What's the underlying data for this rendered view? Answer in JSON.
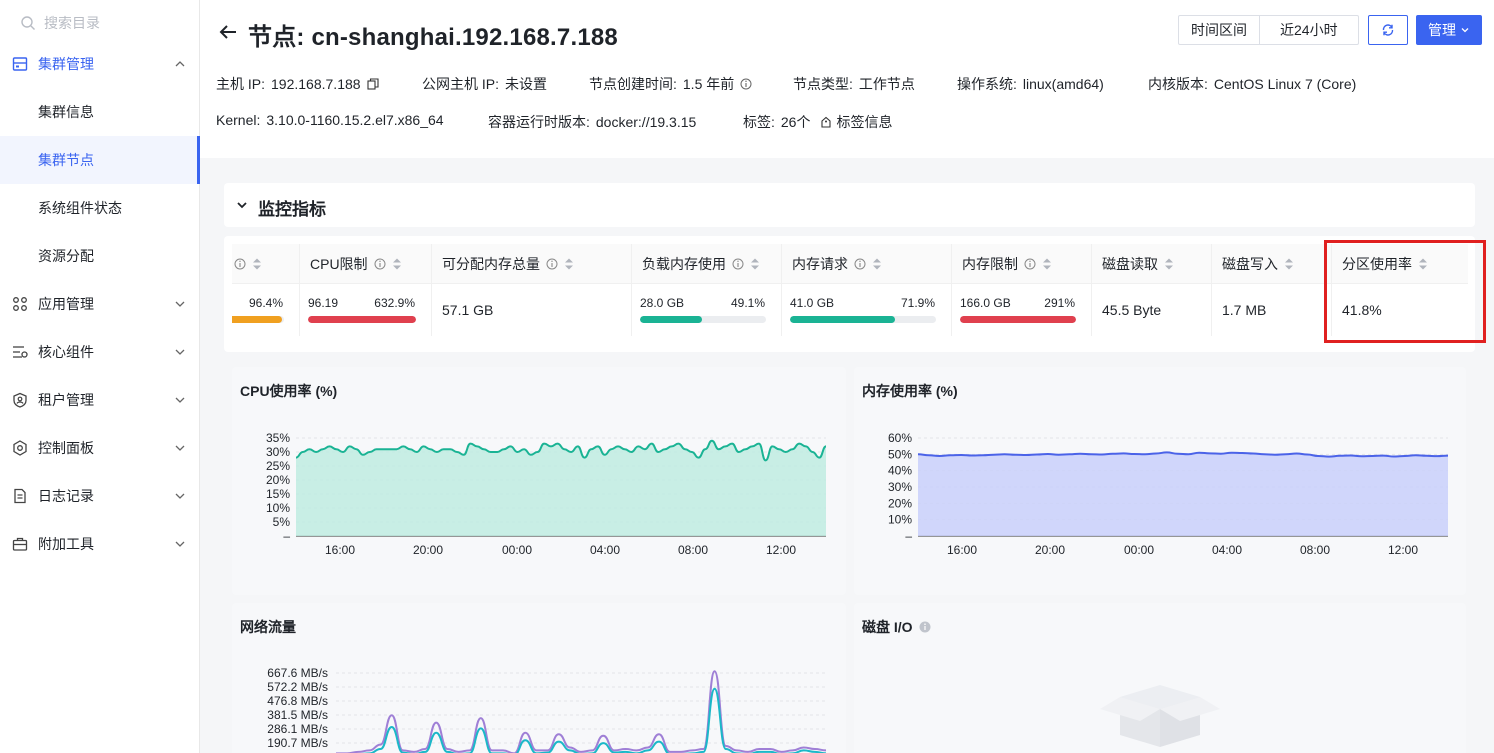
{
  "sidebar": {
    "search_placeholder": "搜索目录",
    "groups": [
      {
        "label": "集群管理",
        "icon": "cluster-icon",
        "expanded": true
      },
      {
        "label": "应用管理",
        "icon": "apps-icon"
      },
      {
        "label": "核心组件",
        "icon": "components-icon"
      },
      {
        "label": "租户管理",
        "icon": "tenant-icon"
      },
      {
        "label": "控制面板",
        "icon": "gear-icon"
      },
      {
        "label": "日志记录",
        "icon": "log-icon"
      },
      {
        "label": "附加工具",
        "icon": "toolbox-icon"
      }
    ],
    "sub_items": [
      "集群信息",
      "集群节点",
      "系统组件状态",
      "资源分配"
    ],
    "active_sub": "集群节点"
  },
  "header": {
    "title": "节点: cn-shanghai.192.168.7.188",
    "time_range_label": "时间区间",
    "time_range_value": "近24小时",
    "manage_label": "管理",
    "meta_row1": [
      {
        "key": "主机 IP:",
        "value": "192.168.7.188"
      },
      {
        "key": "公网主机 IP:",
        "value": "未设置"
      },
      {
        "key": "节点创建时间:",
        "value": "1.5 年前"
      },
      {
        "key": "节点类型:",
        "value": "工作节点"
      },
      {
        "key": "操作系统:",
        "value": "linux(amd64)"
      },
      {
        "key": "内核版本:",
        "value": "CentOS Linux 7 (Core)"
      }
    ],
    "meta_row2": [
      {
        "key": "Kernel:",
        "value": "3.10.0-1160.15.2.el7.x86_64"
      },
      {
        "key": "容器运行时版本:",
        "value": "docker://19.3.15"
      },
      {
        "key": "标签:",
        "value": "26个"
      },
      {
        "key": "",
        "value": "标签信息"
      }
    ]
  },
  "monitor": {
    "section_title": "监控指标",
    "columns": [
      {
        "header": "",
        "left": "",
        "right": "96.4%",
        "fraction": 0.96,
        "color": "#f0a020"
      },
      {
        "header": "CPU限制",
        "left": "96.19",
        "right": "632.9%",
        "fraction": 1.0,
        "color": "#e0404e"
      },
      {
        "header": "可分配内存总量",
        "value": "57.1 GB"
      },
      {
        "header": "负载内存使用",
        "left": "28.0 GB",
        "right": "49.1%",
        "fraction": 0.491,
        "color": "#1ab394"
      },
      {
        "header": "内存请求",
        "left": "41.0 GB",
        "right": "71.9%",
        "fraction": 0.719,
        "color": "#1ab394"
      },
      {
        "header": "内存限制",
        "left": "166.0 GB",
        "right": "291%",
        "fraction": 1.0,
        "color": "#e0404e"
      },
      {
        "header": "磁盘读取",
        "value": "45.5 Byte"
      },
      {
        "header": "磁盘写入",
        "value": "1.7 MB"
      },
      {
        "header": "分区使用率",
        "value": "41.8%"
      }
    ]
  },
  "charts": {
    "cpu_title": "CPU使用率 (%)",
    "mem_title": "内存使用率 (%)",
    "net_title": "网络流量",
    "disk_title": "磁盘 I/O"
  },
  "chart_data": [
    {
      "type": "area",
      "title": "CPU使用率 (%)",
      "x_ticks": [
        "16:00",
        "20:00",
        "00:00",
        "04:00",
        "08:00",
        "12:00"
      ],
      "y_ticks": [
        "–",
        "5%",
        "10%",
        "15%",
        "20%",
        "25%",
        "30%",
        "35%"
      ],
      "ylim": [
        0,
        35
      ],
      "color": "#1ab394",
      "fill": "#bfece0",
      "values": [
        28,
        30,
        31,
        30,
        31,
        32,
        31,
        30,
        32,
        31,
        29,
        30,
        31,
        31,
        31,
        31,
        32,
        31,
        30,
        32,
        31,
        30,
        31,
        31,
        30,
        29,
        33,
        32,
        31,
        30,
        30,
        31,
        32,
        30,
        31,
        29,
        30,
        33,
        32,
        33,
        31,
        30,
        32,
        28,
        31,
        32,
        29,
        31,
        32,
        31,
        30,
        32,
        31,
        33,
        30,
        31,
        32,
        33,
        31,
        30,
        28,
        31,
        34,
        31,
        32,
        33,
        30,
        31,
        32,
        33,
        27,
        32,
        31,
        30,
        31,
        33,
        32,
        30,
        28,
        32
      ]
    },
    {
      "type": "area",
      "title": "内存使用率 (%)",
      "x_ticks": [
        "16:00",
        "20:00",
        "00:00",
        "04:00",
        "08:00",
        "12:00"
      ],
      "y_ticks": [
        "–",
        "10%",
        "20%",
        "30%",
        "40%",
        "50%",
        "60%"
      ],
      "ylim": [
        0,
        60
      ],
      "color": "#4b63e8",
      "fill": "#c9d0fa",
      "values": [
        50,
        49.5,
        49,
        49.4,
        49.6,
        49.3,
        49.5,
        49.8,
        50,
        49.7,
        49.6,
        49.9,
        50.2,
        49.8,
        50,
        50.4,
        50.1,
        49.9,
        50.3,
        50.6,
        50.2,
        50,
        50.5,
        51.2,
        50.4,
        50.1,
        51,
        50.6,
        50.4,
        51,
        50.8,
        50.5,
        50,
        49.8,
        50.1,
        50.5,
        49.9,
        49,
        48.6,
        49.1,
        49.3,
        48.8,
        49,
        49.2,
        48.7,
        49,
        49.4,
        49.1,
        48.9,
        49.2
      ]
    },
    {
      "type": "line",
      "title": "网络流量",
      "y_ticks": [
        "190.7 MB/s",
        "286.1 MB/s",
        "381.5 MB/s",
        "476.8 MB/s",
        "572.2 MB/s",
        "667.6 MB/s"
      ],
      "series": [
        {
          "name": "",
          "color": "#9f7fd6",
          "values": [
            120,
            120,
            130,
            140,
            180,
            380,
            140,
            130,
            150,
            330,
            150,
            130,
            140,
            360,
            140,
            140,
            120,
            260,
            140,
            140,
            250,
            160,
            130,
            140,
            240,
            140,
            150,
            140,
            160,
            250,
            130,
            130,
            140,
            150,
            680,
            170,
            140,
            130,
            150,
            150,
            130,
            140,
            160,
            150,
            140
          ]
        },
        {
          "name": "",
          "color": "#1bb8c8",
          "values": [
            110,
            110,
            115,
            120,
            150,
            300,
            125,
            115,
            130,
            260,
            130,
            115,
            120,
            290,
            120,
            120,
            110,
            210,
            120,
            125,
            200,
            140,
            115,
            120,
            190,
            125,
            130,
            120,
            140,
            200,
            115,
            115,
            120,
            130,
            560,
            150,
            120,
            115,
            130,
            130,
            115,
            120,
            140,
            130,
            120
          ]
        }
      ]
    }
  ]
}
